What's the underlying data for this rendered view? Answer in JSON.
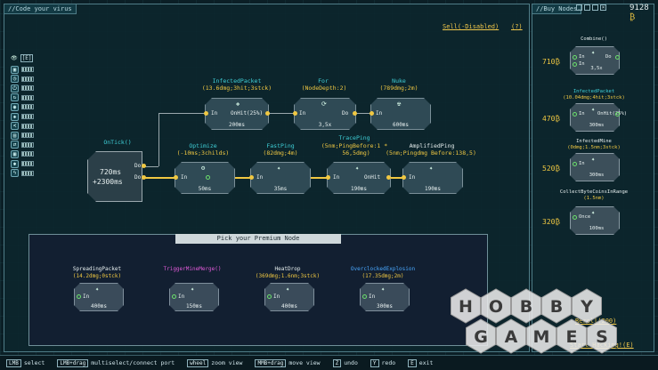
{
  "main_panel": {
    "title": "//Code your virus",
    "sell_label": "Sell(-Disabled)",
    "help_label": "(?)"
  },
  "buy_panel": {
    "title": "//Buy Nodes",
    "money": "9128"
  },
  "window_controls": [
    "minimize",
    "restore",
    "maximize",
    "close"
  ],
  "sidebar": {
    "header_label": "[E]",
    "items": [
      {
        "icon": "packet-icon"
      },
      {
        "icon": "timer-icon"
      },
      {
        "icon": "power-icon"
      },
      {
        "icon": "cycle-icon"
      },
      {
        "icon": "coin-icon"
      },
      {
        "icon": "wifi-icon"
      },
      {
        "icon": "share-icon"
      },
      {
        "icon": "bars-icon"
      },
      {
        "icon": "arrows-icon"
      },
      {
        "icon": "grid-icon"
      },
      {
        "icon": "bug-icon"
      },
      {
        "icon": "antenna-icon"
      }
    ]
  },
  "nodes": {
    "ontick": {
      "title": "OnTick()",
      "value1": "720ms",
      "value2": "+2300ms",
      "port1": "Do",
      "port2": "Do"
    },
    "infected": {
      "title": "InfectedPacket",
      "sub": "(13.6dmg;3hit;3stck)",
      "in": "In",
      "out": "OnHit(25%)",
      "time": "200ms"
    },
    "for": {
      "title": "For",
      "sub": "(NodeDepth:2)",
      "in": "In",
      "out": "Do",
      "time": "3,5x"
    },
    "nuke": {
      "title": "Nuke",
      "sub": "(789dmg;2m)",
      "in": "In",
      "time": "600ms"
    },
    "optimize": {
      "title": "Optimize",
      "sub": "(-10ms;3childs)",
      "in": "In",
      "time": "50ms"
    },
    "fastping": {
      "title": "FastPing",
      "sub": "(82dmg;4m)",
      "in": "In",
      "time": "35ms"
    },
    "traceping": {
      "title": "TracePing",
      "sub": "(5nm;PingBefore:1 *",
      "sub2": "56,5dmg)",
      "in": "In",
      "out": "OnHit",
      "time": "190ms"
    },
    "amplified": {
      "title": "AmplifiedPing",
      "sub": "(5nm;Pingdmg Before:138,5)",
      "in": "In",
      "time": "190ms"
    }
  },
  "premium": {
    "title": "Pick your Premium Node",
    "cards": [
      {
        "title": "SpreadingPacket",
        "sub": "(14.2dmg;0stck)",
        "in": "In",
        "time": "400ms",
        "color": "#e8f0f0"
      },
      {
        "title": "TriggerMineMerge()",
        "sub": "",
        "in": "In",
        "time": "150ms",
        "color": "#e05ad8"
      },
      {
        "title": "HeatDrop",
        "sub": "(369dmg;1.6nm;3stck)",
        "in": "In",
        "time": "400ms",
        "color": "#e8f0f0"
      },
      {
        "title": "OverclockedExplosion",
        "sub": "(17.35dmg;2m)",
        "in": "In",
        "time": "300ms",
        "color": "#49a8ff"
      }
    ]
  },
  "buy_items": [
    {
      "title": "Combine()",
      "sub": "",
      "price": "710",
      "port1": "In",
      "port2": "In",
      "out": "Do",
      "time": "3,5x"
    },
    {
      "title": "InfectedPacket",
      "sub": "(10.04dmg;4hit;3stck)",
      "price": "470",
      "port1": "In",
      "out": "OnHit(25%)",
      "time": "300ms"
    },
    {
      "title": "InfectedMine",
      "sub": "(0dmg;1.5nm;3stck)",
      "price": "520",
      "port1": "In",
      "time": "300ms"
    },
    {
      "title": "CollectByteCoinsInRange",
      "sub": "(1.5nm)",
      "price": "320",
      "port1": "Once",
      "time": "100ms"
    }
  ],
  "reroll_label": "Reroll(200)",
  "start_label": "Start Hacking!(E)",
  "bottom_bar": [
    {
      "key": "LMB",
      "label": "select"
    },
    {
      "key": "LMB+drag",
      "label": "multiselect/connect port"
    },
    {
      "key": "wheel",
      "label": "zoom view"
    },
    {
      "key": "MMB+drag",
      "label": "move view"
    },
    {
      "key": "Z",
      "label": "undo"
    },
    {
      "key": "Y",
      "label": "redo"
    },
    {
      "key": "E",
      "label": "exit"
    }
  ],
  "logo": {
    "line1": "HOBBY",
    "line2": "GAMES"
  },
  "colors": {
    "accent": "#f0c842",
    "cyan": "#3fd0d8",
    "bg": "#0b1f26"
  }
}
